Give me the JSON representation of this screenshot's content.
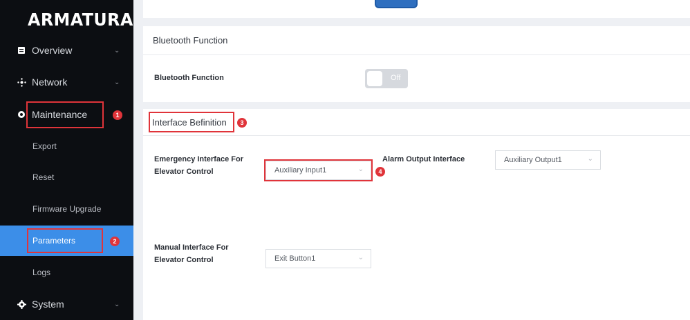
{
  "brand": {
    "logo_text": "ARMATURA"
  },
  "sidebar": {
    "items": [
      {
        "label": "Overview",
        "icon": "document-icon"
      },
      {
        "label": "Network",
        "icon": "network-icon"
      },
      {
        "label": "Maintenance",
        "icon": "wrench-icon"
      },
      {
        "label": "System",
        "icon": "gear-icon"
      }
    ],
    "sub_items": [
      {
        "label": "Export"
      },
      {
        "label": "Reset"
      },
      {
        "label": "Firmware Upgrade"
      },
      {
        "label": "Parameters",
        "active": true
      },
      {
        "label": "Logs"
      }
    ]
  },
  "bluetooth": {
    "section_title": "Bluetooth Function",
    "field_label": "Bluetooth Function",
    "toggle_state": "Off"
  },
  "interface": {
    "section_title": "Interface Befinition",
    "emergency_label_line1": "Emergency Interface For",
    "emergency_label_line2": "Elevator Control",
    "emergency_value": "Auxiliary Input1",
    "alarm_label": "Alarm Output Interface",
    "alarm_value": "Auxiliary Output1",
    "manual_label_line1": "Manual Interface For",
    "manual_label_line2": "Elevator Control",
    "manual_value": "Exit Button1"
  },
  "annotations": {
    "b1": "1",
    "b2": "2",
    "b3": "3",
    "b4": "4"
  },
  "colors": {
    "sidebar_bg": "#0c0e12",
    "active": "#3c8ee8",
    "highlight": "#e0343a",
    "main_bg": "#eef0f4"
  }
}
